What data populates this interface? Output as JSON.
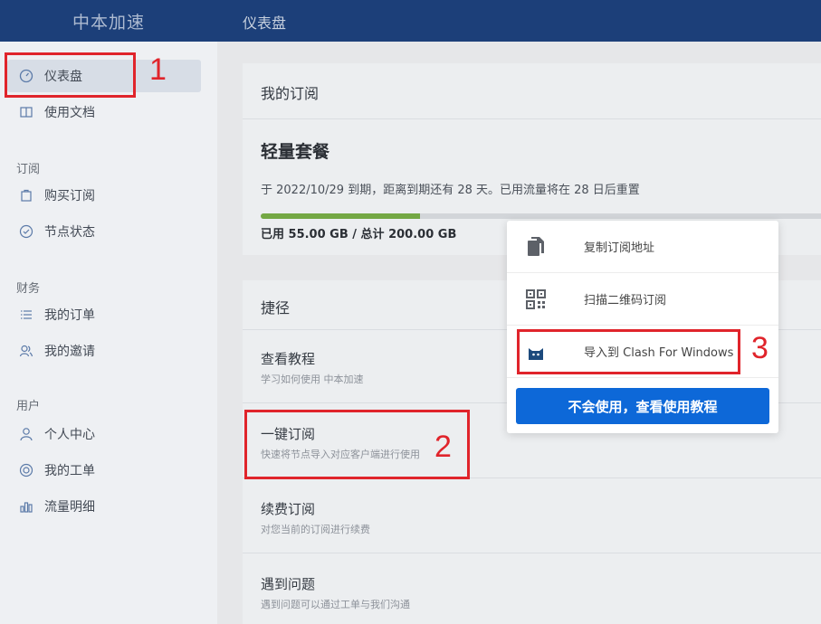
{
  "sidebar": {
    "brand": "中本加速",
    "items": [
      {
        "label": "仪表盘",
        "icon": "dashboard-icon"
      },
      {
        "label": "使用文档",
        "icon": "book-icon"
      }
    ],
    "groups": [
      {
        "title": "订阅",
        "items": [
          {
            "label": "购买订阅",
            "icon": "bag-icon"
          },
          {
            "label": "节点状态",
            "icon": "check-circle-icon"
          }
        ]
      },
      {
        "title": "财务",
        "items": [
          {
            "label": "我的订单",
            "icon": "list-icon"
          },
          {
            "label": "我的邀请",
            "icon": "users-icon"
          }
        ]
      },
      {
        "title": "用户",
        "items": [
          {
            "label": "个人中心",
            "icon": "user-icon"
          },
          {
            "label": "我的工单",
            "icon": "support-icon"
          },
          {
            "label": "流量明细",
            "icon": "bar-chart-icon"
          }
        ]
      }
    ]
  },
  "header": {
    "title": "仪表盘"
  },
  "subscription": {
    "heading": "我的订阅",
    "plan": "轻量套餐",
    "expiry_text": "于 2022/10/29 到期，距离到期还有 28 天。已用流量将在 28 日后重置",
    "used_fraction": 0.275,
    "usage_text": "已用 55.00 GB / 总计 200.00 GB"
  },
  "shortcuts": {
    "heading": "捷径",
    "items": [
      {
        "title": "查看教程",
        "desc": "学习如何使用 中本加速"
      },
      {
        "title": "一键订阅",
        "desc": "快速将节点导入对应客户端进行使用"
      },
      {
        "title": "续费订阅",
        "desc": "对您当前的订阅进行续费"
      },
      {
        "title": "遇到问题",
        "desc": "遇到问题可以通过工单与我们沟通"
      }
    ]
  },
  "popup": {
    "items": [
      {
        "label": "复制订阅地址",
        "icon": "copy-icon"
      },
      {
        "label": "扫描二维码订阅",
        "icon": "qr-code-icon"
      },
      {
        "label": "导入到 Clash For Windows",
        "icon": "clash-cat-icon"
      }
    ],
    "button": "不会使用，查看使用教程"
  },
  "annotations": [
    "1",
    "2",
    "3"
  ],
  "colors": {
    "header": "#1c3f79",
    "accent": "#0d68d8",
    "annotation": "#e0242b",
    "progress": "#74a844"
  }
}
